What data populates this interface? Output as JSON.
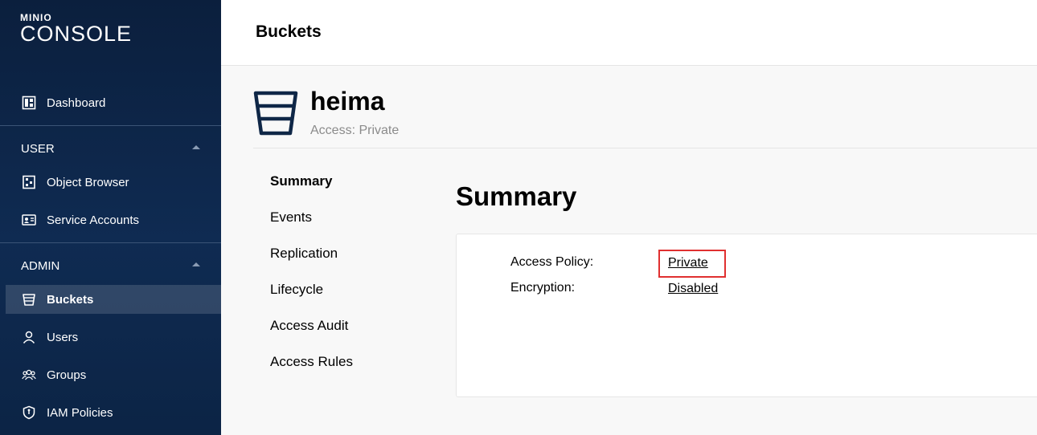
{
  "brand": {
    "small": "MINIO",
    "big": "CONSOLE"
  },
  "sidebar": {
    "dashboard": {
      "label": "Dashboard",
      "icon": "dashboard-icon"
    },
    "user_section": {
      "label": "USER",
      "items": [
        {
          "label": "Object Browser",
          "icon": "object-browser-icon"
        },
        {
          "label": "Service Accounts",
          "icon": "service-accounts-icon"
        }
      ]
    },
    "admin_section": {
      "label": "ADMIN",
      "items": [
        {
          "label": "Buckets",
          "icon": "bucket-icon",
          "active": true
        },
        {
          "label": "Users",
          "icon": "user-icon"
        },
        {
          "label": "Groups",
          "icon": "groups-icon"
        },
        {
          "label": "IAM Policies",
          "icon": "shield-icon"
        }
      ]
    }
  },
  "header": {
    "title": "Buckets"
  },
  "bucket": {
    "name": "heima",
    "access": "Access: Private"
  },
  "tabs": [
    {
      "label": "Summary",
      "active": true
    },
    {
      "label": "Events"
    },
    {
      "label": "Replication"
    },
    {
      "label": "Lifecycle"
    },
    {
      "label": "Access Audit"
    },
    {
      "label": "Access Rules"
    }
  ],
  "main": {
    "title": "Summary",
    "rows": [
      {
        "label": "Access Policy:",
        "value": "Private"
      },
      {
        "label": "Encryption:",
        "value": "Disabled"
      }
    ]
  },
  "colors": {
    "sidebar_bg": "#0f2b52",
    "highlight_border": "#e03030"
  }
}
